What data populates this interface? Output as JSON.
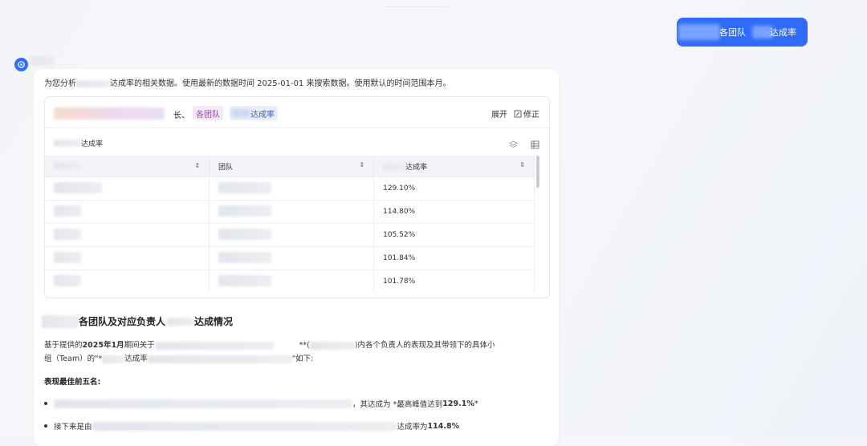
{
  "user_message": {
    "visible_text": "各团队",
    "visible_text2": "达成率"
  },
  "intro": "为您分析",
  "intro_tail": "达成率的相关数据。使用最新的数据时间 2025-01-01 来搜索数据。使用默认的时间范围本月。",
  "result_card": {
    "chip_sep": "长、",
    "chip_team": "各团队",
    "chip_rate": "达成率",
    "expand_label": "展开",
    "correct_label": "修正",
    "table_title": "达成率",
    "columns": [
      "",
      "团队",
      "达成率"
    ],
    "rows": [
      "129.10%",
      "114.80%",
      "105.52%",
      "101.84%",
      "101.78%"
    ]
  },
  "section": {
    "title": "各团队及对应负责人",
    "title_tail": "达成情况",
    "para1_a": "基于提供的",
    "para1_bold": "2025年1月",
    "para1_b": "期间关于",
    "para1_c": "**(",
    "para1_d": ")内各个负责人的表现及其带领下的具体小",
    "para2_a": "组（Team）的\"*",
    "para2_b": "达成率",
    "para2_c": "\"如下:",
    "best_five": "表现最佳前五名:",
    "bullet1_a": "，其达成为 *最高峰值达到 ",
    "bullet1_bold": "129.1%",
    "bullet1_b": " *",
    "bullet2_a": "接下来是由",
    "bullet2_b": "达成率为 ",
    "bullet2_bold": "114.8%"
  }
}
